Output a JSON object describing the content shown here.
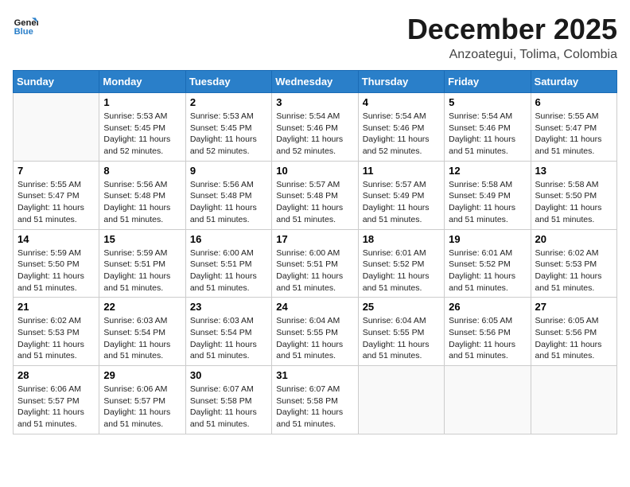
{
  "header": {
    "logo_line1": "General",
    "logo_line2": "Blue",
    "month_title": "December 2025",
    "subtitle": "Anzoategui, Tolima, Colombia"
  },
  "weekdays": [
    "Sunday",
    "Monday",
    "Tuesday",
    "Wednesday",
    "Thursday",
    "Friday",
    "Saturday"
  ],
  "weeks": [
    [
      {
        "day": "",
        "info": ""
      },
      {
        "day": "1",
        "info": "Sunrise: 5:53 AM\nSunset: 5:45 PM\nDaylight: 11 hours\nand 52 minutes."
      },
      {
        "day": "2",
        "info": "Sunrise: 5:53 AM\nSunset: 5:45 PM\nDaylight: 11 hours\nand 52 minutes."
      },
      {
        "day": "3",
        "info": "Sunrise: 5:54 AM\nSunset: 5:46 PM\nDaylight: 11 hours\nand 52 minutes."
      },
      {
        "day": "4",
        "info": "Sunrise: 5:54 AM\nSunset: 5:46 PM\nDaylight: 11 hours\nand 52 minutes."
      },
      {
        "day": "5",
        "info": "Sunrise: 5:54 AM\nSunset: 5:46 PM\nDaylight: 11 hours\nand 51 minutes."
      },
      {
        "day": "6",
        "info": "Sunrise: 5:55 AM\nSunset: 5:47 PM\nDaylight: 11 hours\nand 51 minutes."
      }
    ],
    [
      {
        "day": "7",
        "info": "Sunrise: 5:55 AM\nSunset: 5:47 PM\nDaylight: 11 hours\nand 51 minutes."
      },
      {
        "day": "8",
        "info": "Sunrise: 5:56 AM\nSunset: 5:48 PM\nDaylight: 11 hours\nand 51 minutes."
      },
      {
        "day": "9",
        "info": "Sunrise: 5:56 AM\nSunset: 5:48 PM\nDaylight: 11 hours\nand 51 minutes."
      },
      {
        "day": "10",
        "info": "Sunrise: 5:57 AM\nSunset: 5:48 PM\nDaylight: 11 hours\nand 51 minutes."
      },
      {
        "day": "11",
        "info": "Sunrise: 5:57 AM\nSunset: 5:49 PM\nDaylight: 11 hours\nand 51 minutes."
      },
      {
        "day": "12",
        "info": "Sunrise: 5:58 AM\nSunset: 5:49 PM\nDaylight: 11 hours\nand 51 minutes."
      },
      {
        "day": "13",
        "info": "Sunrise: 5:58 AM\nSunset: 5:50 PM\nDaylight: 11 hours\nand 51 minutes."
      }
    ],
    [
      {
        "day": "14",
        "info": "Sunrise: 5:59 AM\nSunset: 5:50 PM\nDaylight: 11 hours\nand 51 minutes."
      },
      {
        "day": "15",
        "info": "Sunrise: 5:59 AM\nSunset: 5:51 PM\nDaylight: 11 hours\nand 51 minutes."
      },
      {
        "day": "16",
        "info": "Sunrise: 6:00 AM\nSunset: 5:51 PM\nDaylight: 11 hours\nand 51 minutes."
      },
      {
        "day": "17",
        "info": "Sunrise: 6:00 AM\nSunset: 5:51 PM\nDaylight: 11 hours\nand 51 minutes."
      },
      {
        "day": "18",
        "info": "Sunrise: 6:01 AM\nSunset: 5:52 PM\nDaylight: 11 hours\nand 51 minutes."
      },
      {
        "day": "19",
        "info": "Sunrise: 6:01 AM\nSunset: 5:52 PM\nDaylight: 11 hours\nand 51 minutes."
      },
      {
        "day": "20",
        "info": "Sunrise: 6:02 AM\nSunset: 5:53 PM\nDaylight: 11 hours\nand 51 minutes."
      }
    ],
    [
      {
        "day": "21",
        "info": "Sunrise: 6:02 AM\nSunset: 5:53 PM\nDaylight: 11 hours\nand 51 minutes."
      },
      {
        "day": "22",
        "info": "Sunrise: 6:03 AM\nSunset: 5:54 PM\nDaylight: 11 hours\nand 51 minutes."
      },
      {
        "day": "23",
        "info": "Sunrise: 6:03 AM\nSunset: 5:54 PM\nDaylight: 11 hours\nand 51 minutes."
      },
      {
        "day": "24",
        "info": "Sunrise: 6:04 AM\nSunset: 5:55 PM\nDaylight: 11 hours\nand 51 minutes."
      },
      {
        "day": "25",
        "info": "Sunrise: 6:04 AM\nSunset: 5:55 PM\nDaylight: 11 hours\nand 51 minutes."
      },
      {
        "day": "26",
        "info": "Sunrise: 6:05 AM\nSunset: 5:56 PM\nDaylight: 11 hours\nand 51 minutes."
      },
      {
        "day": "27",
        "info": "Sunrise: 6:05 AM\nSunset: 5:56 PM\nDaylight: 11 hours\nand 51 minutes."
      }
    ],
    [
      {
        "day": "28",
        "info": "Sunrise: 6:06 AM\nSunset: 5:57 PM\nDaylight: 11 hours\nand 51 minutes."
      },
      {
        "day": "29",
        "info": "Sunrise: 6:06 AM\nSunset: 5:57 PM\nDaylight: 11 hours\nand 51 minutes."
      },
      {
        "day": "30",
        "info": "Sunrise: 6:07 AM\nSunset: 5:58 PM\nDaylight: 11 hours\nand 51 minutes."
      },
      {
        "day": "31",
        "info": "Sunrise: 6:07 AM\nSunset: 5:58 PM\nDaylight: 11 hours\nand 51 minutes."
      },
      {
        "day": "",
        "info": ""
      },
      {
        "day": "",
        "info": ""
      },
      {
        "day": "",
        "info": ""
      }
    ]
  ]
}
